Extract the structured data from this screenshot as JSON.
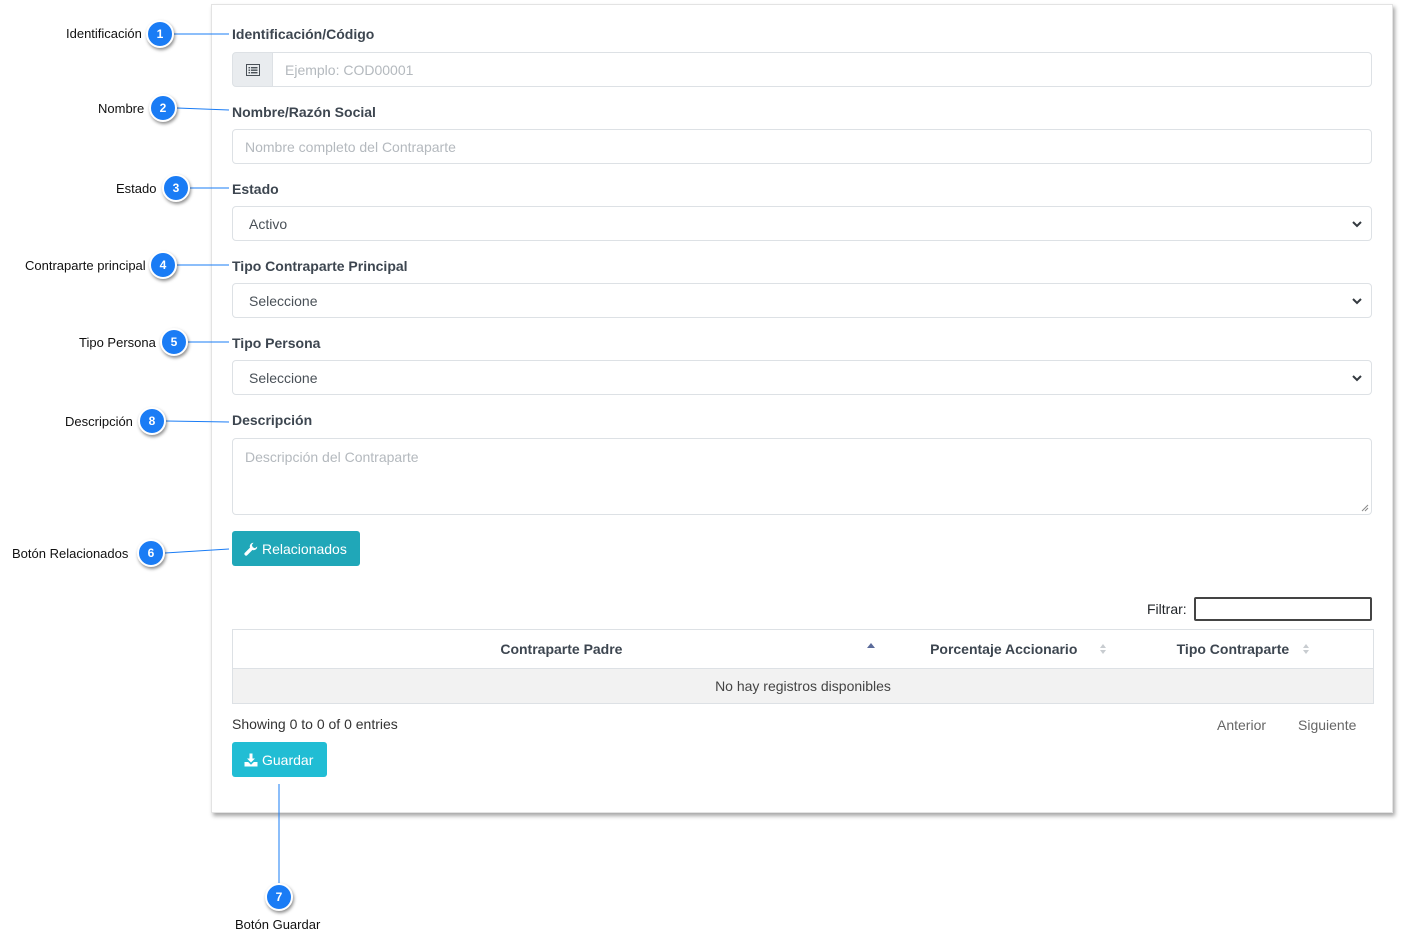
{
  "form": {
    "id_label": "Identificación/Código",
    "id_placeholder": "Ejemplo: COD00001",
    "name_label": "Nombre/Razón Social",
    "name_placeholder": "Nombre completo del Contraparte",
    "status_label": "Estado",
    "status_value": "Activo",
    "main_type_label": "Tipo Contraparte Principal",
    "main_type_value": "Seleccione",
    "person_type_label": "Tipo Persona",
    "person_type_value": "Seleccione",
    "description_label": "Descripción",
    "description_placeholder": "Descripción del Contraparte",
    "related_button": "Relacionados",
    "save_button": "Guardar"
  },
  "table": {
    "filter_label": "Filtrar:",
    "columns": [
      "Contraparte Padre",
      "Porcentaje Accionario",
      "Tipo Contraparte"
    ],
    "empty_message": "No hay registros disponibles",
    "info": "Showing 0 to 0 of 0 entries",
    "prev": "Anterior",
    "next": "Siguiente"
  },
  "callouts": [
    {
      "number": "1",
      "label": "Identificación"
    },
    {
      "number": "2",
      "label": "Nombre"
    },
    {
      "number": "3",
      "label": "Estado"
    },
    {
      "number": "4",
      "label": "Contraparte principal"
    },
    {
      "number": "5",
      "label": "Tipo Persona"
    },
    {
      "number": "8",
      "label": "Descripción"
    },
    {
      "number": "6",
      "label": "Botón  Relacionados"
    },
    {
      "number": "7",
      "label": "Botón  Guardar"
    }
  ],
  "colors": {
    "badge": "#1a7cf5",
    "callout_line": "#1a7cf5",
    "button_related": "#20a7b8",
    "button_save": "#21bdd4"
  },
  "icons": [
    "list-icon",
    "wrench-icon",
    "download-icon",
    "chevron-down-icon",
    "sort-icon"
  ]
}
